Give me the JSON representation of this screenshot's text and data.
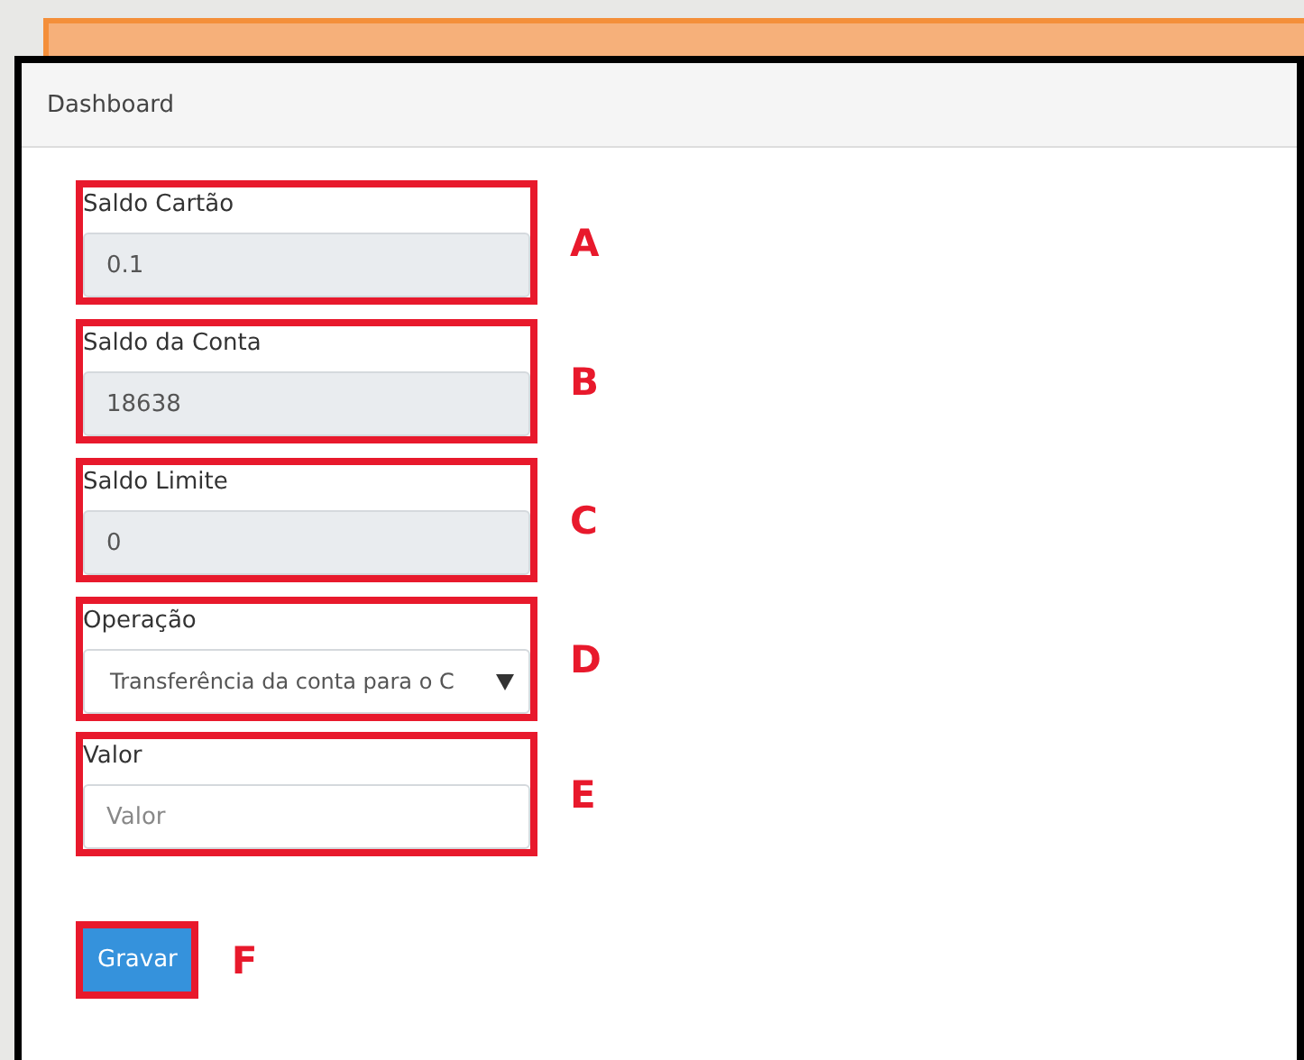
{
  "panel": {
    "title": "Dashboard"
  },
  "fields": [
    {
      "kind": "readonly",
      "label": "Saldo Cartão",
      "value": "0.1",
      "marker": "A"
    },
    {
      "kind": "readonly",
      "label": "Saldo da Conta",
      "value": "18638",
      "marker": "B"
    },
    {
      "kind": "readonly",
      "label": "Saldo Limite",
      "value": "0",
      "marker": "C"
    },
    {
      "kind": "select",
      "label": "Operação",
      "value": "Transferência da conta para o C",
      "marker": "D"
    },
    {
      "kind": "input",
      "label": "Valor",
      "placeholder": "Valor",
      "marker": "E"
    }
  ],
  "submit": {
    "label": "Gravar",
    "marker": "F"
  }
}
